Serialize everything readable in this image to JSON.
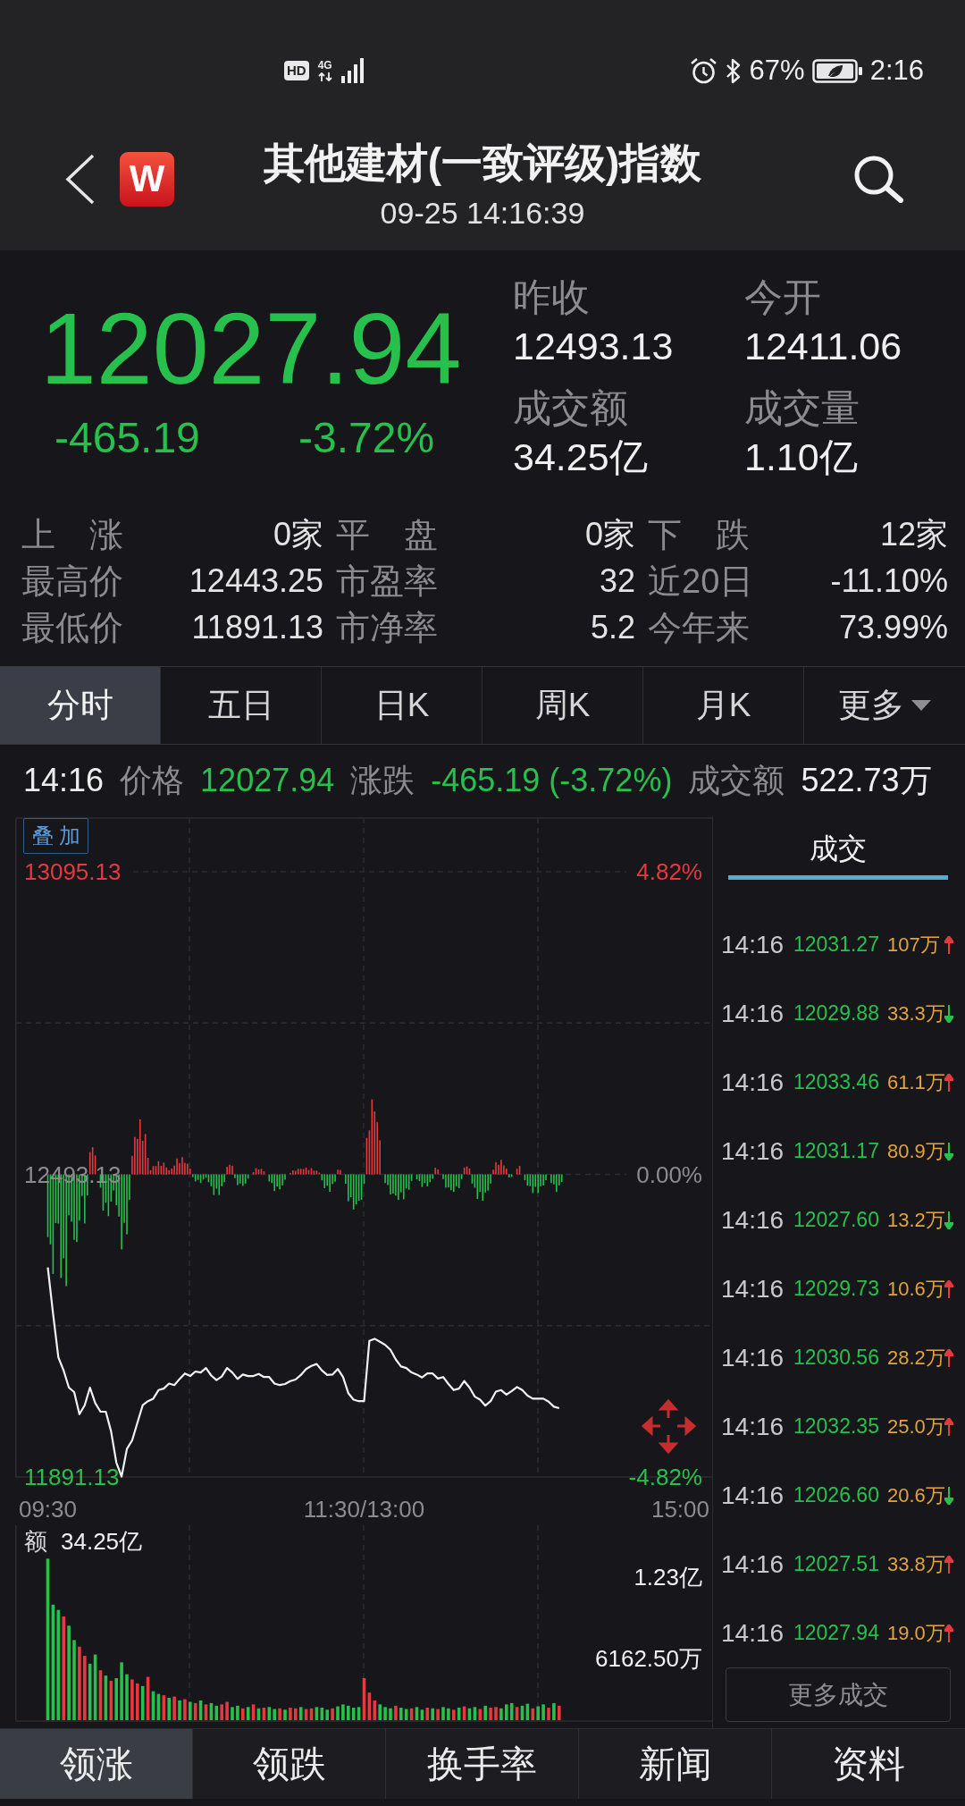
{
  "status_bar": {
    "hd": "HD",
    "network": "4G",
    "battery_percent": "67%",
    "time": "2:16"
  },
  "header": {
    "logo": "W",
    "title": "其他建材(一致评级)指数",
    "subtitle": "09-25 14:16:39"
  },
  "quote": {
    "price": "12027.94",
    "change": "-465.19",
    "change_percent": "-3.72%",
    "rising": false,
    "stats": [
      {
        "label": "昨收",
        "value": "12493.13"
      },
      {
        "label": "今开",
        "value": "12411.06"
      },
      {
        "label": "成交额",
        "value": "34.25亿"
      },
      {
        "label": "成交量",
        "value": "1.10亿"
      }
    ]
  },
  "breadth": [
    {
      "cells": [
        {
          "label": "上 涨",
          "value": "0家"
        },
        {
          "label": "平 盘",
          "value": "0家"
        },
        {
          "label": "下 跌",
          "value": "12家"
        }
      ]
    },
    {
      "cells": [
        {
          "label": "最高价",
          "value": "12443.25"
        },
        {
          "label": "市盈率",
          "value": "32"
        },
        {
          "label": "近20日",
          "value": "-11.10%"
        }
      ]
    },
    {
      "cells": [
        {
          "label": "最低价",
          "value": "11891.13"
        },
        {
          "label": "市净率",
          "value": "5.2"
        },
        {
          "label": "今年来",
          "value": "73.99%"
        }
      ]
    }
  ],
  "period_tabs": [
    {
      "label": "分时",
      "selected": true,
      "kind": "tab"
    },
    {
      "label": "五日",
      "selected": false,
      "kind": "tab"
    },
    {
      "label": "日K",
      "selected": false,
      "kind": "tab"
    },
    {
      "label": "周K",
      "selected": false,
      "kind": "tab"
    },
    {
      "label": "月K",
      "selected": false,
      "kind": "tab"
    },
    {
      "label": "更多",
      "selected": false,
      "kind": "menu"
    }
  ],
  "info_line": {
    "time": "14:16",
    "items": [
      {
        "label": "价格",
        "value": "12027.94",
        "kind": "trend"
      },
      {
        "label": "涨跌",
        "value": "-465.19 (-3.72%)",
        "kind": "trend"
      },
      {
        "label": "成交额",
        "value": "522.73万",
        "kind": "plain"
      }
    ]
  },
  "price_chart": {
    "overlay_button": "叠加",
    "percent_labels": [
      "4.82%",
      "0.00%",
      "-4.82%"
    ],
    "chart_data": {
      "type": "line",
      "categories": [
        "09:30",
        null,
        null,
        null,
        null,
        null,
        null,
        null,
        null,
        null,
        null,
        null,
        null,
        null,
        null,
        null,
        null,
        null,
        null,
        null,
        null,
        null,
        null,
        null,
        null,
        null,
        null,
        null,
        null,
        null,
        null,
        null,
        null,
        null,
        null,
        null,
        null,
        null,
        null,
        null,
        null,
        null,
        null,
        null,
        null,
        null,
        null,
        null,
        null,
        null,
        null,
        null,
        null,
        null,
        null,
        null,
        null,
        null,
        null,
        null,
        "11:30/13:00",
        null,
        null,
        null,
        null,
        null,
        null,
        null,
        null,
        null,
        null,
        null,
        null,
        null,
        null,
        null,
        null,
        null,
        null,
        null,
        null,
        null,
        null,
        null,
        null,
        null,
        null,
        null,
        null,
        null,
        null,
        null,
        null,
        null,
        null,
        null,
        null,
        null,
        null,
        null,
        null,
        null,
        null,
        null,
        null,
        null,
        null,
        null,
        null,
        null,
        null,
        null,
        null,
        null,
        null,
        null,
        null,
        null,
        null,
        null,
        "15:00"
      ],
      "series": [
        {
          "color": "#f2f2f2",
          "values": [
            12308,
            12216,
            12129,
            12103,
            12069,
            12060,
            12016,
            12034,
            12069,
            12038,
            12021,
            12021,
            11982,
            11920,
            11892,
            11947,
            11964,
            11999,
            12034,
            12042,
            12047,
            12064,
            12067,
            12077,
            12074,
            12086,
            12097,
            12092,
            12101,
            12099,
            12108,
            12093,
            12084,
            12091,
            12108,
            12099,
            12086,
            12095,
            12092,
            12092,
            12096,
            12090,
            12090,
            12077,
            12074,
            12076,
            12082,
            12085,
            12094,
            12106,
            12112,
            12116,
            12103,
            12094,
            12095,
            12106,
            12090,
            12058,
            12045,
            12042,
            12042,
            12162,
            12166,
            12160,
            12154,
            12144,
            12125,
            12111,
            12108,
            12099,
            12095,
            12089,
            12097,
            12097,
            12087,
            12090,
            12076,
            12064,
            12067,
            12082,
            12069,
            12051,
            12045,
            12033,
            12042,
            12061,
            12064,
            12055,
            12062,
            12070,
            12064,
            12053,
            12047,
            12047,
            12047,
            12041,
            12031,
            12028,
            null,
            null,
            null,
            null,
            null,
            null,
            null,
            null,
            null,
            null,
            null,
            null,
            null,
            null,
            null,
            null,
            null,
            null,
            null,
            null,
            null,
            null,
            null
          ]
        }
      ],
      "ylim": [
        11891.13,
        13095.13
      ],
      "yticks": [
        {
          "value": 11891.13,
          "label": "11891.13"
        },
        {
          "value": 12493.13,
          "label": "12493.13"
        },
        {
          "value": 13095.13,
          "label": "13095.13"
        }
      ]
    }
  },
  "volume_chart": {
    "label": "额",
    "total": "34.25亿",
    "axis_labels": [
      "1.23亿",
      "6162.50万"
    ]
  },
  "trades_panel": {
    "tab": {
      "label": "成交",
      "selected": true
    },
    "trades": [
      {
        "time": "14:16",
        "price": "12031.27",
        "volume": "107万",
        "rising": true
      },
      {
        "time": "14:16",
        "price": "12029.88",
        "volume": "33.3万",
        "rising": false
      },
      {
        "time": "14:16",
        "price": "12033.46",
        "volume": "61.1万",
        "rising": true
      },
      {
        "time": "14:16",
        "price": "12031.17",
        "volume": "80.9万",
        "rising": false
      },
      {
        "time": "14:16",
        "price": "12027.60",
        "volume": "13.2万",
        "rising": false
      },
      {
        "time": "14:16",
        "price": "12029.73",
        "volume": "10.6万",
        "rising": true
      },
      {
        "time": "14:16",
        "price": "12030.56",
        "volume": "28.2万",
        "rising": true
      },
      {
        "time": "14:16",
        "price": "12032.35",
        "volume": "25.0万",
        "rising": true
      },
      {
        "time": "14:16",
        "price": "12026.60",
        "volume": "20.6万",
        "rising": false
      },
      {
        "time": "14:16",
        "price": "12027.51",
        "volume": "33.8万",
        "rising": true
      },
      {
        "time": "14:16",
        "price": "12027.94",
        "volume": "19.0万",
        "rising": true
      }
    ],
    "more_button": "更多成交"
  },
  "bottom_tabs": [
    {
      "label": "领涨",
      "selected": true
    },
    {
      "label": "领跌",
      "selected": false
    },
    {
      "label": "换手率",
      "selected": false
    },
    {
      "label": "新闻",
      "selected": false
    },
    {
      "label": "资料",
      "selected": false
    }
  ]
}
